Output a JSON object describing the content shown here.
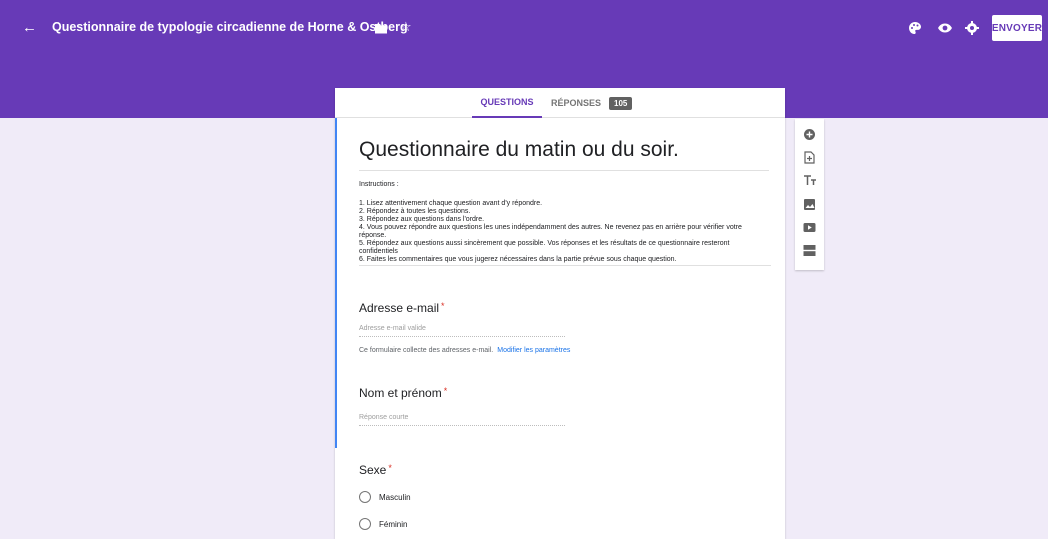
{
  "header": {
    "form_title": "Questionnaire de typologie circadienne de Horne & Ostberg",
    "back_icon": "arrow-left-icon",
    "send_label": "ENVOYER",
    "accent_color": "#673ab7"
  },
  "tabs": {
    "questions": "QUESTIONS",
    "responses": "RÉPONSES",
    "responses_count": "105"
  },
  "form": {
    "title": "Questionnaire du matin ou du soir.",
    "instructions_intro": "Instructions :",
    "instructions": [
      "1. Lisez attentivement chaque question avant d'y répondre.",
      "2. Répondez à toutes les questions.",
      "3. Répondez aux questions dans l'ordre.",
      "4. Vous pouvez répondre aux questions les unes indépendamment des autres. Ne revenez pas en arrière pour vérifier votre",
      "réponse.",
      "5. Répondez aux questions aussi sincèrement que possible. Vos réponses et les résultats de ce questionnaire resteront",
      "confidentiels",
      "6. Faites les commentaires que vous jugerez nécessaires dans la partie prévue sous chaque question."
    ],
    "required_marker": "*"
  },
  "questions": [
    {
      "title": "Adresse e-mail",
      "placeholder": "Adresse e-mail valide",
      "note": "Ce formulaire collecte des adresses e-mail.",
      "link": "Modifier les paramètres"
    },
    {
      "title": "Nom et prénom",
      "placeholder": "Réponse courte"
    },
    {
      "title": "Sexe",
      "options": [
        "Masculin",
        "Féminin"
      ]
    }
  ],
  "toolbar": [
    "add-question-icon",
    "import-questions-icon",
    "add-title-icon",
    "add-image-icon",
    "add-video-icon",
    "add-section-icon"
  ]
}
